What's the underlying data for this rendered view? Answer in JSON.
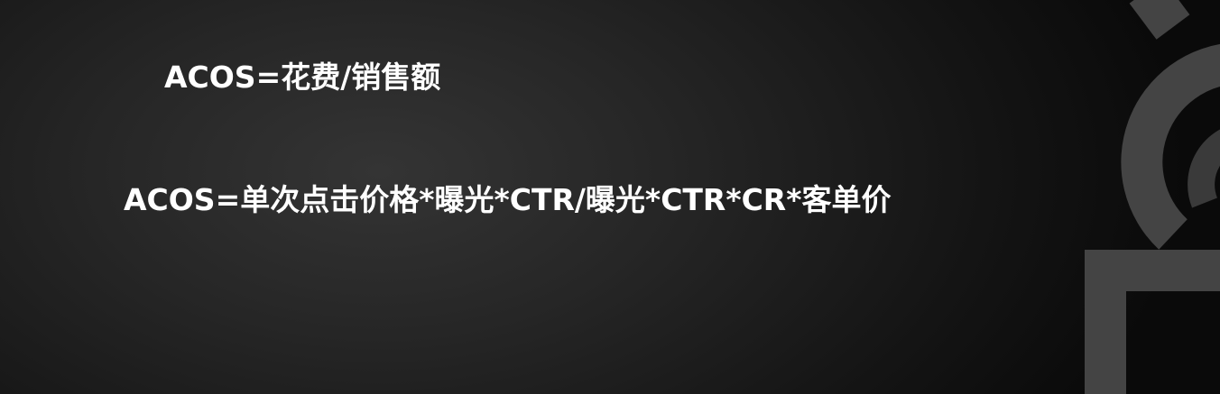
{
  "slide": {
    "formula_simple": "ACOS=花费/销售额",
    "formula_expanded": "ACOS=单次点击价格*曝光*CTR/曝光*CTR*CR*客单价"
  },
  "colors": {
    "background": "#1c1c1c",
    "text": "#ffffff",
    "watermark": "#4a4a4a"
  },
  "icons": {
    "watermark": "brand-logo-watermark"
  }
}
